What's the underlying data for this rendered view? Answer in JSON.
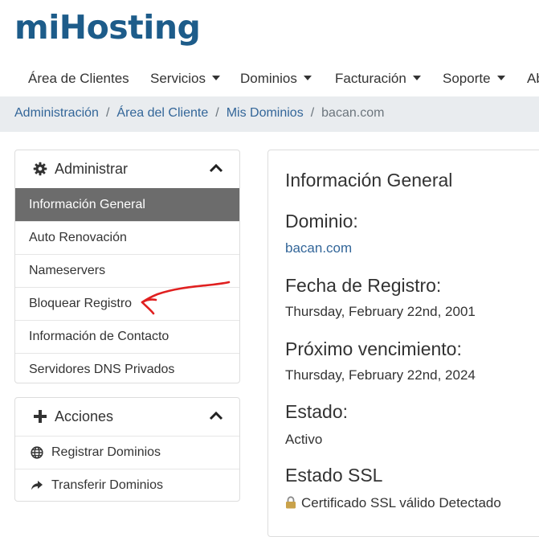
{
  "brand": {
    "logo": "miHosting"
  },
  "topnav": {
    "items": [
      {
        "label": "Área de Clientes",
        "dropdown": false
      },
      {
        "label": "Servicios",
        "dropdown": true
      },
      {
        "label": "Dominios",
        "dropdown": true
      },
      {
        "label": "Facturación",
        "dropdown": true
      },
      {
        "label": "Soporte",
        "dropdown": true
      },
      {
        "label": "Ab",
        "dropdown": false
      }
    ]
  },
  "breadcrumb": {
    "items": [
      "Administración",
      "Área del Cliente",
      "Mis Dominios"
    ],
    "current": "bacan.com"
  },
  "sidebar": {
    "administrar": {
      "title": "Administrar",
      "icon": "gear-icon",
      "items": [
        {
          "label": "Información General",
          "active": true
        },
        {
          "label": "Auto Renovación",
          "active": false
        },
        {
          "label": "Nameservers",
          "active": false
        },
        {
          "label": "Bloquear Registro",
          "active": false
        },
        {
          "label": "Información de Contacto",
          "active": false
        },
        {
          "label": "Servidores DNS Privados",
          "active": false
        }
      ]
    },
    "acciones": {
      "title": "Acciones",
      "icon": "plus-icon",
      "items": [
        {
          "label": "Registrar Dominios",
          "icon": "globe-icon"
        },
        {
          "label": "Transferir Dominios",
          "icon": "share-arrow-icon"
        }
      ]
    }
  },
  "main": {
    "title": "Información General",
    "dominio_label": "Dominio:",
    "dominio_value": "bacan.com",
    "fecha_registro_label": "Fecha de Registro:",
    "fecha_registro_value": "Thursday, February 22nd, 2001",
    "vencimiento_label": "Próximo vencimiento:",
    "vencimiento_value": "Thursday, February 22nd, 2024",
    "estado_label": "Estado:",
    "estado_value": "Activo",
    "ssl_label": "Estado SSL",
    "ssl_value": "Certificado SSL válido Detectado"
  },
  "colors": {
    "brand": "#1d5c8a",
    "link": "#336699",
    "active_item_bg": "#6c6c6c",
    "breadcrumb_bg": "#e9ecef",
    "annotation_arrow": "#e02020"
  }
}
